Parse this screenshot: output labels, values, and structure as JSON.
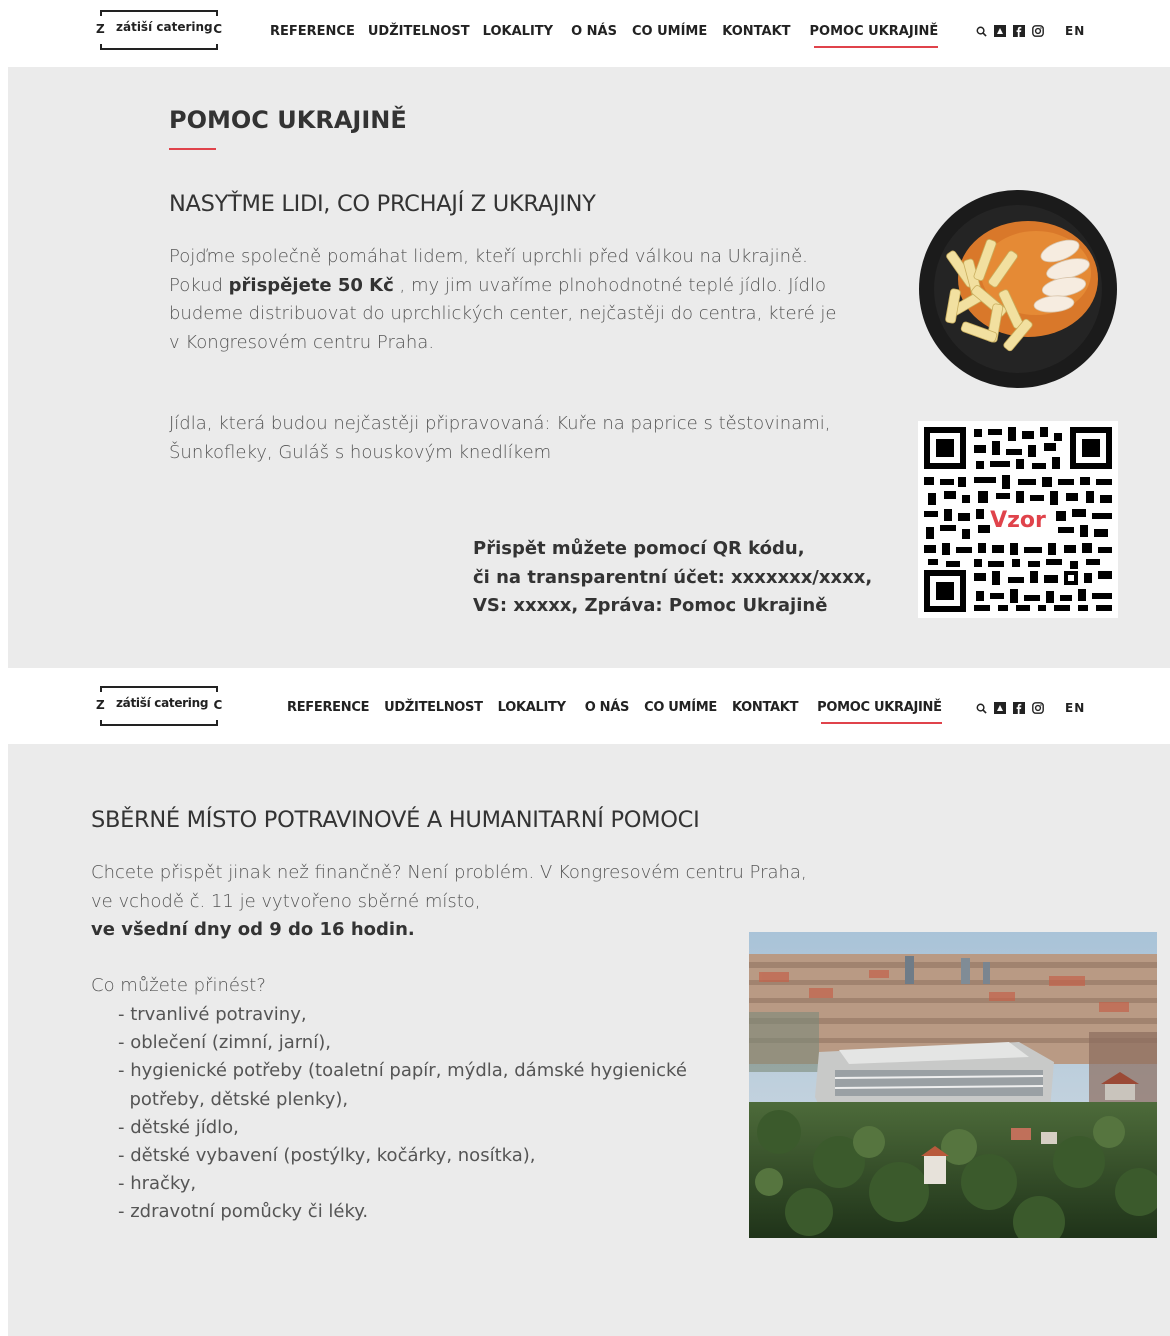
{
  "logo": {
    "left_letter": "Z",
    "name": "zátiší catering",
    "right_letter": "C"
  },
  "nav": {
    "items": [
      "REFERENCE",
      "UDŽITELNOST",
      "LOKALITY",
      "O NÁS",
      "CO UMÍME",
      "KONTAKT",
      "POMOC UKRAJINĚ"
    ],
    "active": "POMOC UKRAJINĚ",
    "lang": "EN"
  },
  "icons": [
    "search-icon",
    "account-icon",
    "facebook-icon",
    "instagram-icon"
  ],
  "colors": {
    "accent": "#e0434b",
    "panel_bg": "#ebebeb",
    "text": "#333333"
  },
  "section1": {
    "title": "POMOC UKRAJINĚ",
    "heading": "NASYŤME LIDI, CO PRCHAJÍ Z UKRAJINY",
    "p1_a": "Pojďme společně pomáhat lidem, kteří uprchli před válkou na Ukrajině.",
    "p1_b_pre": "Pokud ",
    "p1_b_bold": "přispějete 50 Kč",
    "p1_b_post": " , my jim uvaříme plnohodnotné teplé jídlo. Jídlo",
    "p1_c": "budeme distribuovat do uprchlických center, nejčastěji do centra, které je",
    "p1_d": "v Kongresovém centru Praha.",
    "p2_a": "Jídla, která budou nejčastěji připravovaná: Kuře na paprice s těstovinami,",
    "p2_b": "Šunkofleky, Guláš s houskovým knedlíkem",
    "qr_line1": "Přispět můžete pomocí QR kódu,",
    "qr_line2": "či na transparentní účet: xxxxxxx/xxxx,",
    "qr_line3": "VS: xxxxx, Zpráva: Pomoc Ukrajině",
    "qr_watermark": "Vzor"
  },
  "section2": {
    "heading": "SBĚRNÉ MÍSTO POTRAVINOVÉ A HUMANITARNÍ POMOCI",
    "p1": "Chcete přispět jinak než finančně? Není problém. V Kongresovém centru  Praha,",
    "p2": "ve vchodě č. 11 je vytvořeno sběrné místo,",
    "p3_bold": "ve všední dny od 9 do 16 hodin.",
    "question": "Co můžete přinést?",
    "items": [
      "- trvanlivé potraviny,",
      "- oblečení (zimní, jarní),",
      "- hygienické potřeby (toaletní papír, mýdla, dámské hygienické",
      "  potřeby, dětské plenky),",
      "- dětské jídlo,",
      "- dětské vybavení (postýlky, kočárky, nosítka),",
      "- hračky,",
      "- zdravotní pomůcky či léky."
    ]
  }
}
